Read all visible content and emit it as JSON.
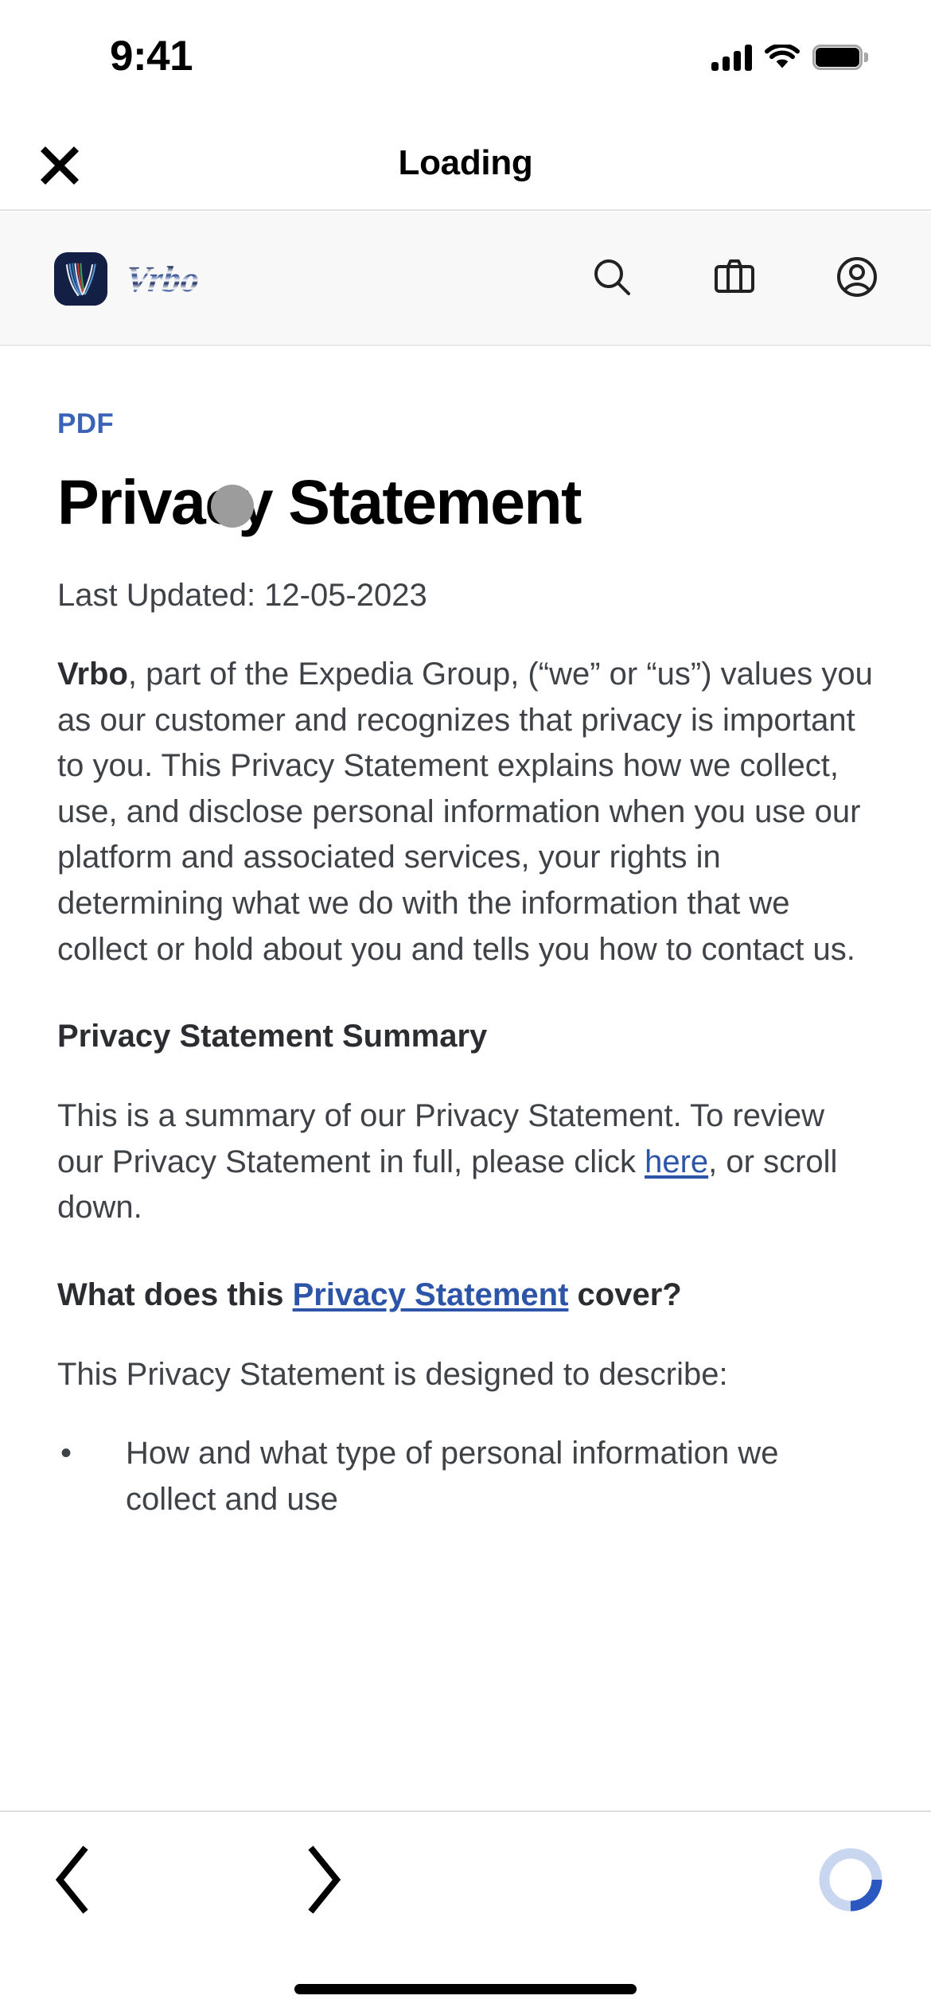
{
  "status_bar": {
    "time": "9:41",
    "signal_icon": "cellular-signal-icon",
    "wifi_icon": "wifi-icon",
    "battery_icon": "battery-full-icon"
  },
  "app_bar": {
    "close_icon": "close-icon",
    "title": "Loading"
  },
  "brand_bar": {
    "logo_name": "vrbo-logo",
    "wordmark": "Vrbo",
    "actions": [
      {
        "name": "search-icon",
        "label": "Search"
      },
      {
        "name": "trips-icon",
        "label": "Trips"
      },
      {
        "name": "account-icon",
        "label": "Account"
      }
    ]
  },
  "document": {
    "kicker": "PDF",
    "title": "Privacy Statement",
    "last_updated": "Last Updated: 12-05-2023",
    "intro": {
      "lead": "Vrbo",
      "rest": ", part of the Expedia Group, (“we” or “us”) values you as our customer and recognizes that privacy is important to you. This Privacy Statement explains how we collect, use, and disclose personal information when you use our platform and associated services, your rights in determining what we do with the information that we collect or hold about you and tells you how to contact us."
    },
    "summary_heading": "Privacy Statement Summary",
    "summary": {
      "before_link": "This is a summary of our Privacy Statement. To review our Privacy Statement in full, please click ",
      "link_text": "here",
      "after_link": ", or scroll down."
    },
    "cover_heading": {
      "before_link": "What does this ",
      "link_text": "Privacy Statement",
      "after_link": " cover?"
    },
    "describe_intro": "This Privacy Statement is designed to describe:",
    "bullets": [
      "How and what type of personal information we collect and use"
    ]
  },
  "toolbar": {
    "back_icon": "chevron-left-icon",
    "forward_icon": "chevron-right-icon",
    "loading_icon": "loading-spinner-icon"
  },
  "home_indicator": "home-indicator",
  "colors": {
    "link_blue": "#2c54a8",
    "pdf_blue": "#3a62b8",
    "brand_navy": "#141f45",
    "body_text": "#3f4247",
    "brandbar_bg": "#f9f8f9",
    "spinner_track": "#c9d6ef",
    "spinner_arc": "#2a58c0"
  }
}
